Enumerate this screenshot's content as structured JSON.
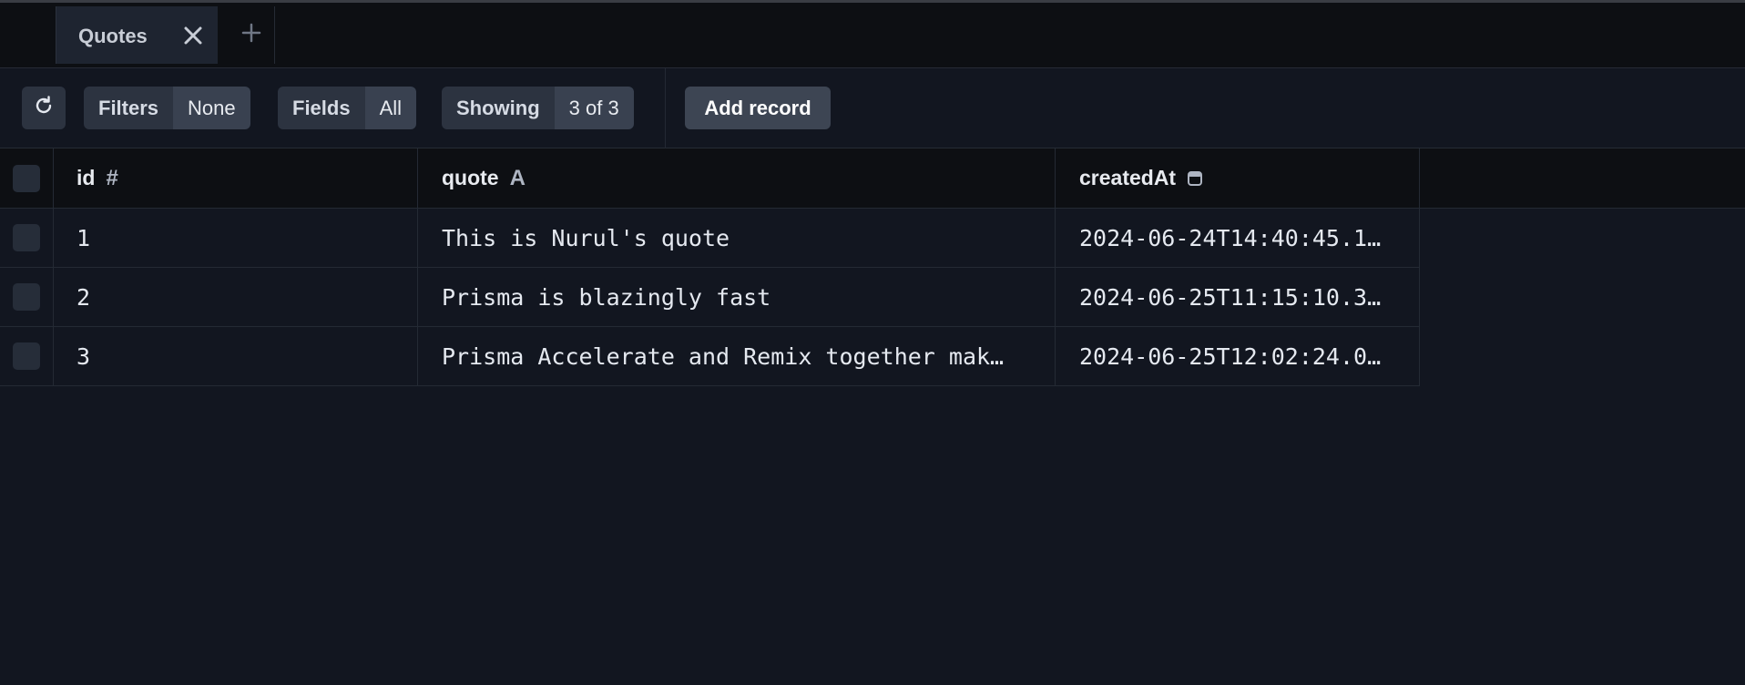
{
  "tabs": [
    {
      "label": "Quotes",
      "active": true
    }
  ],
  "toolbar": {
    "filters": {
      "key": "Filters",
      "value": "None"
    },
    "fields": {
      "key": "Fields",
      "value": "All"
    },
    "showing": {
      "key": "Showing",
      "value": "3 of 3"
    },
    "add_record_label": "Add record"
  },
  "table": {
    "columns": [
      {
        "name": "id",
        "type_icon": "#"
      },
      {
        "name": "quote",
        "type_icon": "A"
      },
      {
        "name": "createdAt",
        "type_icon": "calendar-icon"
      }
    ],
    "rows": [
      {
        "id": "1",
        "quote": "This is Nurul's quote",
        "createdAt": "2024-06-24T14:40:45.1…"
      },
      {
        "id": "2",
        "quote": "Prisma is blazingly fast",
        "createdAt": "2024-06-25T11:15:10.3…"
      },
      {
        "id": "3",
        "quote": "Prisma Accelerate and Remix together mak…",
        "createdAt": "2024-06-25T12:02:24.0…"
      }
    ]
  },
  "colors": {
    "background": "#121620",
    "tabbar": "#0d0f13",
    "pill_key": "#2c3340",
    "pill_value": "#394150",
    "add_button": "#3d4553"
  }
}
